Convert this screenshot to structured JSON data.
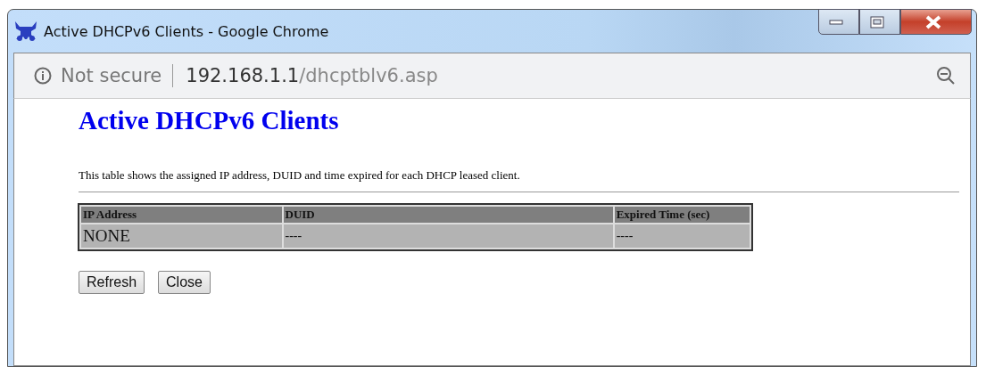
{
  "window": {
    "title": "Active DHCPv6 Clients - Google Chrome"
  },
  "address_bar": {
    "security": "Not secure",
    "url_host": "192.168.1.1",
    "url_path": "/dhcptblv6.asp"
  },
  "page": {
    "heading": "Active DHCPv6 Clients",
    "description": "This table shows the assigned IP address, DUID and time expired for each DHCP leased client.",
    "table": {
      "columns": [
        "IP Address",
        "DUID",
        "Expired Time (sec)"
      ],
      "rows": [
        [
          "NONE",
          "----",
          "----"
        ]
      ]
    },
    "buttons": [
      "Refresh",
      "Close"
    ]
  }
}
